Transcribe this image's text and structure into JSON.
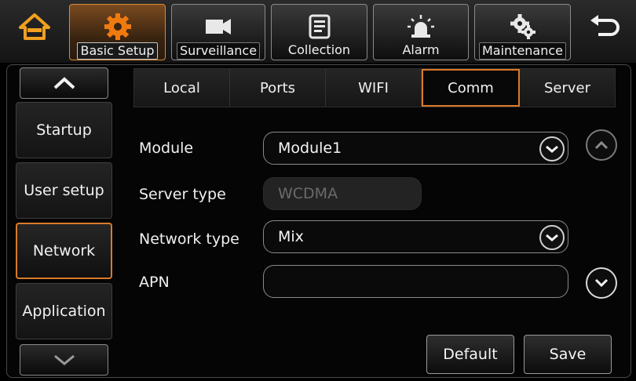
{
  "topbar": {
    "home_icon": "home-icon",
    "back_icon": "back-arrow-icon",
    "tabs": [
      {
        "label": "Basic Setup",
        "icon": "gear-icon",
        "active": true
      },
      {
        "label": "Surveillance",
        "icon": "camera-icon",
        "active": false
      },
      {
        "label": "Collection",
        "icon": "collection-icon",
        "active": false
      },
      {
        "label": "Alarm",
        "icon": "alarm-icon",
        "active": false
      },
      {
        "label": "Maintenance",
        "icon": "maintenance-gear-icon",
        "active": false
      }
    ],
    "accent_color": "#f0a020"
  },
  "sidebar": {
    "items": [
      {
        "label": "Startup"
      },
      {
        "label": "User setup"
      },
      {
        "label": "Network"
      },
      {
        "label": "Application"
      }
    ],
    "active_index": 2
  },
  "subtabs": [
    {
      "label": "Local"
    },
    {
      "label": "Ports"
    },
    {
      "label": "WIFI"
    },
    {
      "label": "Comm"
    },
    {
      "label": "Server"
    }
  ],
  "form": {
    "module": {
      "label": "Module",
      "value": "Module1"
    },
    "server_type": {
      "label": "Server type",
      "value": "WCDMA"
    },
    "network_type": {
      "label": "Network type",
      "value": "Mix"
    },
    "apn": {
      "label": "APN",
      "value": ""
    }
  },
  "actions": {
    "default_label": "Default",
    "save_label": "Save"
  },
  "colors": {
    "accent_orange": "#d97a2a",
    "background": "#000000"
  }
}
